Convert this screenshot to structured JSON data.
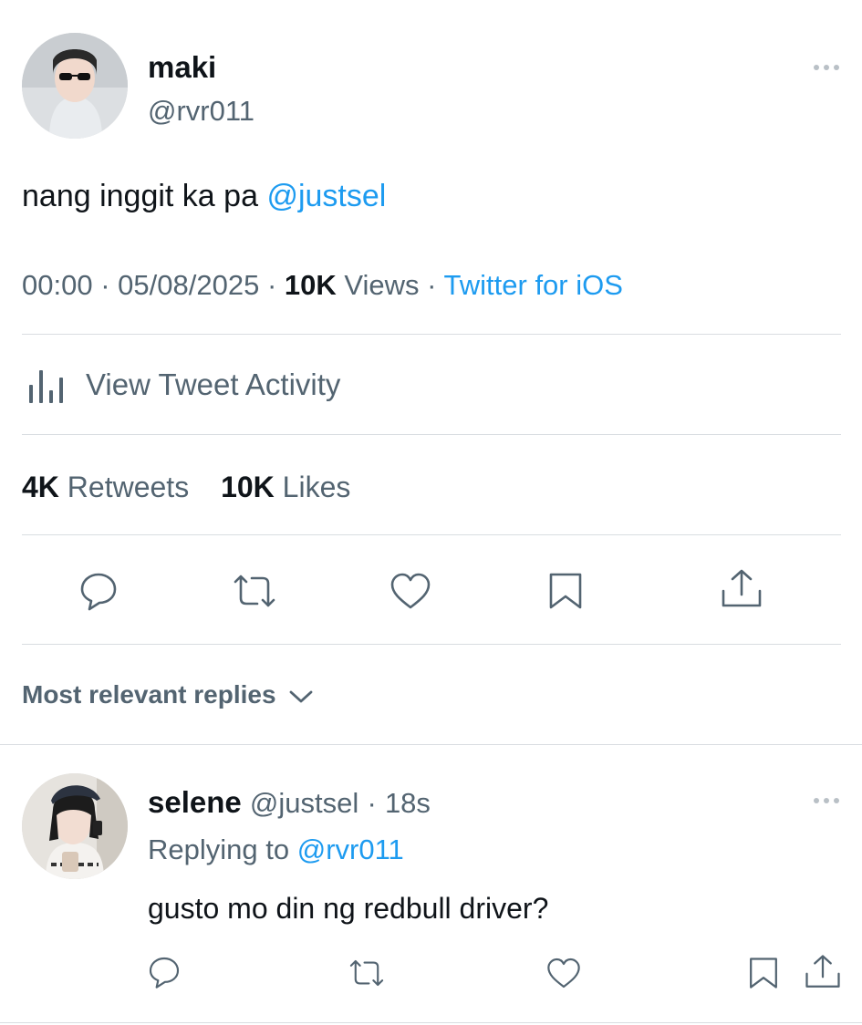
{
  "tweet": {
    "display_name": "maki",
    "handle": "@rvr011",
    "text": "nang inggit ka pa ",
    "mention": "@justsel",
    "time": "00:00",
    "sep1": "·",
    "date": "05/08/2025",
    "sep2": "·",
    "views_count": "10K",
    "views_label": "Views",
    "sep3": "·",
    "source": "Twitter for iOS"
  },
  "activity": {
    "label": "View Tweet Activity"
  },
  "stats": {
    "retweets_count": "4K",
    "retweets_label": "Retweets",
    "likes_count": "10K",
    "likes_label": "Likes"
  },
  "replies_sort": {
    "label": "Most relevant replies"
  },
  "reply": {
    "display_name": "selene",
    "handle": "@justsel",
    "sep": "·",
    "age": "18s",
    "replying_prefix": "Replying to ",
    "replying_to": "@rvr011",
    "text": "gusto mo din ng redbull driver?"
  },
  "icons": {
    "more": "more-horizontal-icon",
    "activity": "bar-chart-icon",
    "reply": "reply-bubble-icon",
    "retweet": "retweet-icon",
    "like": "heart-icon",
    "bookmark": "bookmark-icon",
    "share": "share-icon",
    "chevron": "chevron-down-icon"
  },
  "colors": {
    "link": "#1d9bf0",
    "text": "#0f1419",
    "muted": "#536471",
    "divider": "#d9dde1"
  }
}
